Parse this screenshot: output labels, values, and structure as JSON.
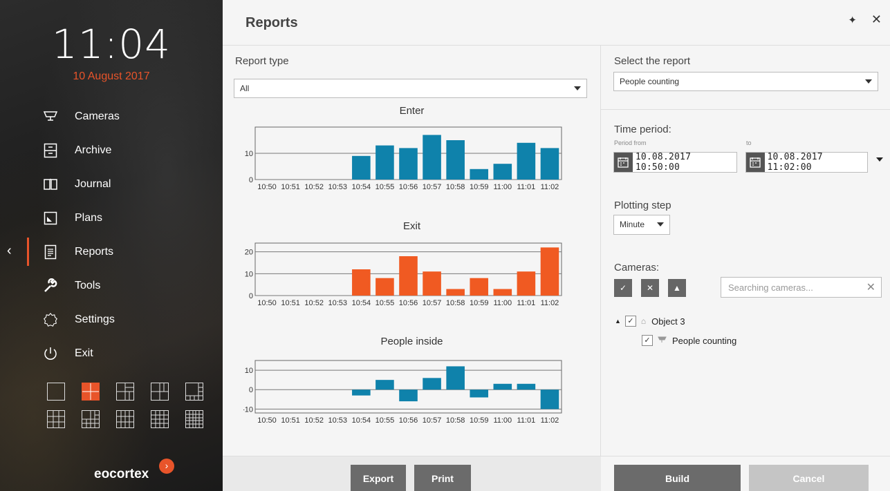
{
  "clock": {
    "time": "11:04",
    "date": "10 August 2017"
  },
  "nav": [
    {
      "label": "Cameras",
      "icon": "camera-icon"
    },
    {
      "label": "Archive",
      "icon": "archive-icon"
    },
    {
      "label": "Journal",
      "icon": "journal-icon"
    },
    {
      "label": "Plans",
      "icon": "plans-icon"
    },
    {
      "label": "Reports",
      "icon": "reports-icon",
      "active": true
    },
    {
      "label": "Tools",
      "icon": "wrench-icon"
    },
    {
      "label": "Settings",
      "icon": "gear-icon"
    },
    {
      "label": "Exit",
      "icon": "power-icon"
    }
  ],
  "layouts": [
    "1x1",
    "2x2",
    "1+5",
    "2x3",
    "1+7",
    "3x3",
    "1+12",
    "4x3",
    "4x4",
    "5x5"
  ],
  "active_layout": "2x2",
  "brand": {
    "name": "eocortex"
  },
  "header": {
    "title": "Reports"
  },
  "middle": {
    "report_type_label": "Report type",
    "report_type_value": "All",
    "export_label": "Export",
    "print_label": "Print"
  },
  "chart_data": [
    {
      "type": "bar",
      "title": "Enter",
      "color": "#0f82ab",
      "categories": [
        "10:50",
        "10:51",
        "10:52",
        "10:53",
        "10:54",
        "10:55",
        "10:56",
        "10:57",
        "10:58",
        "10:59",
        "11:00",
        "11:01",
        "11:02"
      ],
      "values": [
        0,
        0,
        0,
        0,
        9,
        13,
        12,
        17,
        15,
        4,
        6,
        14,
        12
      ],
      "ticks": [
        0,
        10
      ],
      "ylim": [
        0,
        20
      ]
    },
    {
      "type": "bar",
      "title": "Exit",
      "color": "#f05a22",
      "categories": [
        "10:50",
        "10:51",
        "10:52",
        "10:53",
        "10:54",
        "10:55",
        "10:56",
        "10:57",
        "10:58",
        "10:59",
        "11:00",
        "11:01",
        "11:02"
      ],
      "values": [
        0,
        0,
        0,
        0,
        12,
        8,
        18,
        11,
        3,
        8,
        3,
        11,
        22
      ],
      "ticks": [
        0,
        10,
        20
      ],
      "ylim": [
        0,
        24
      ]
    },
    {
      "type": "bar",
      "title": "People inside",
      "color": "#0f82ab",
      "categories": [
        "10:50",
        "10:51",
        "10:52",
        "10:53",
        "10:54",
        "10:55",
        "10:56",
        "10:57",
        "10:58",
        "10:59",
        "11:00",
        "11:01",
        "11:02"
      ],
      "values": [
        0,
        0,
        0,
        0,
        -3,
        5,
        -6,
        6,
        12,
        -4,
        3,
        3,
        -10
      ],
      "ticks": [
        -10,
        0,
        10
      ],
      "ylim": [
        -12,
        15
      ]
    }
  ],
  "right": {
    "select_report_label": "Select the report",
    "select_report_value": "People counting",
    "time_period_label": "Time period:",
    "period_from_label": "Period from",
    "period_to_label": "to",
    "period_from_value": "10.08.2017  10:50:00",
    "period_to_value": "10.08.2017  11:02:00",
    "plotting_step_label": "Plotting step",
    "plotting_step_value": "Minute",
    "cameras_label": "Cameras:",
    "search_placeholder": "Searching cameras...",
    "tree": {
      "object": "Object 3",
      "camera": "People counting"
    },
    "build_label": "Build",
    "cancel_label": "Cancel"
  }
}
